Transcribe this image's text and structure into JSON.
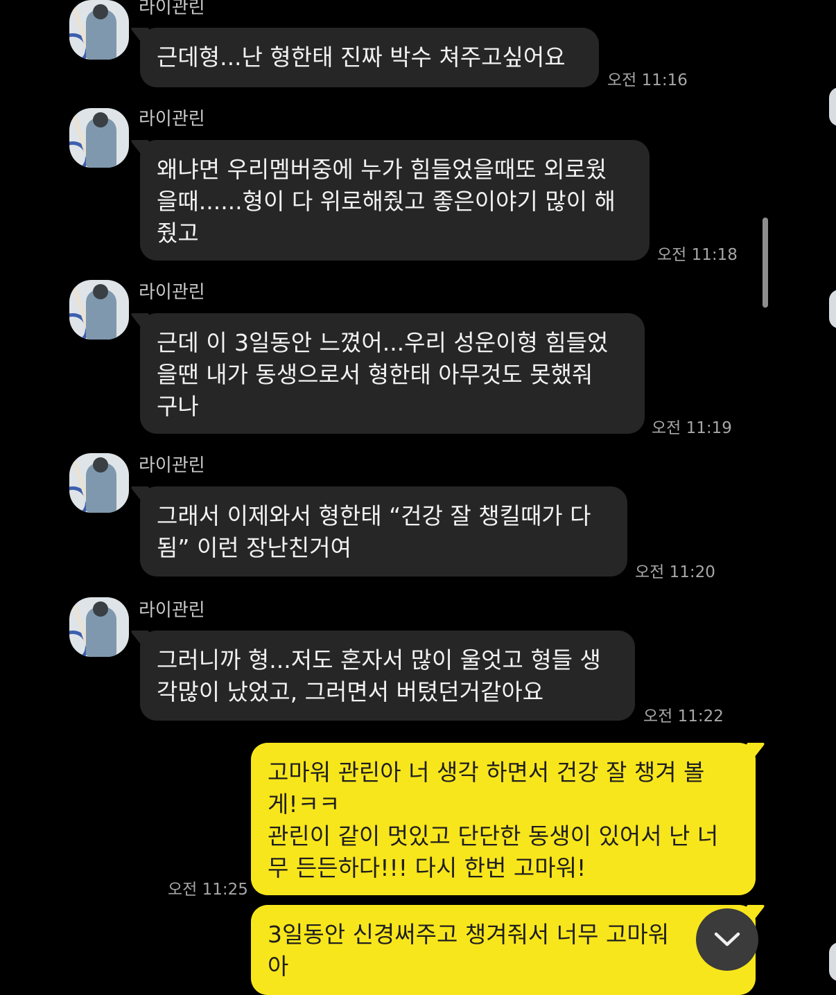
{
  "messages": [
    {
      "sender": "라이관린",
      "text": "근데형...난 형한태 진짜 박수 쳐주고싶어요",
      "time": "오전 11:16"
    },
    {
      "sender": "라이관린",
      "text": "왜냐면 우리멤버중에 누가 힘들었을때또 외로웠\n을때......형이 다 위로해줬고 좋은이야기 많이 해\n줬고",
      "time": "오전 11:18"
    },
    {
      "sender": "라이관린",
      "text": "근데 이 3일동안 느꼈어...우리 성운이형 힘들었\n을땐 내가 동생으로서 형한태 아무것도 못했줘\n구나",
      "time": "오전 11:19"
    },
    {
      "sender": "라이관린",
      "text": "그래서 이제와서 형한태 “건강 잘 챙킬때가 다\n됨” 이런 장난친거여",
      "time": "오전 11:20"
    },
    {
      "sender": "라이관린",
      "text": "그러니까 형...저도 혼자서 많이 울엇고 형들 생\n각많이 났었고, 그러면서 버텼던거같아요",
      "time": "오전 11:22"
    }
  ],
  "outgoing": [
    {
      "text": "고마워 관린아 너 생각 하면서 건강 잘 챙겨 볼\n게!ㅋㅋ\n관린이 같이 멋있고 단단한 동생이 있어서 난 너\n무 든든하다!!! 다시 한번 고마워!",
      "time": "오전 11:25"
    },
    {
      "text": "3일동안 신경써주고 챙겨줘서 너무 고마워\n아"
    }
  ],
  "icons": {
    "scroll_down": "chevron-down-icon",
    "avatar": "profile-photo"
  },
  "colors": {
    "background": "#000000",
    "incoming_bubble": "#262626",
    "outgoing_bubble": "#f8e61c",
    "timestamp": "#a7a7a7"
  }
}
